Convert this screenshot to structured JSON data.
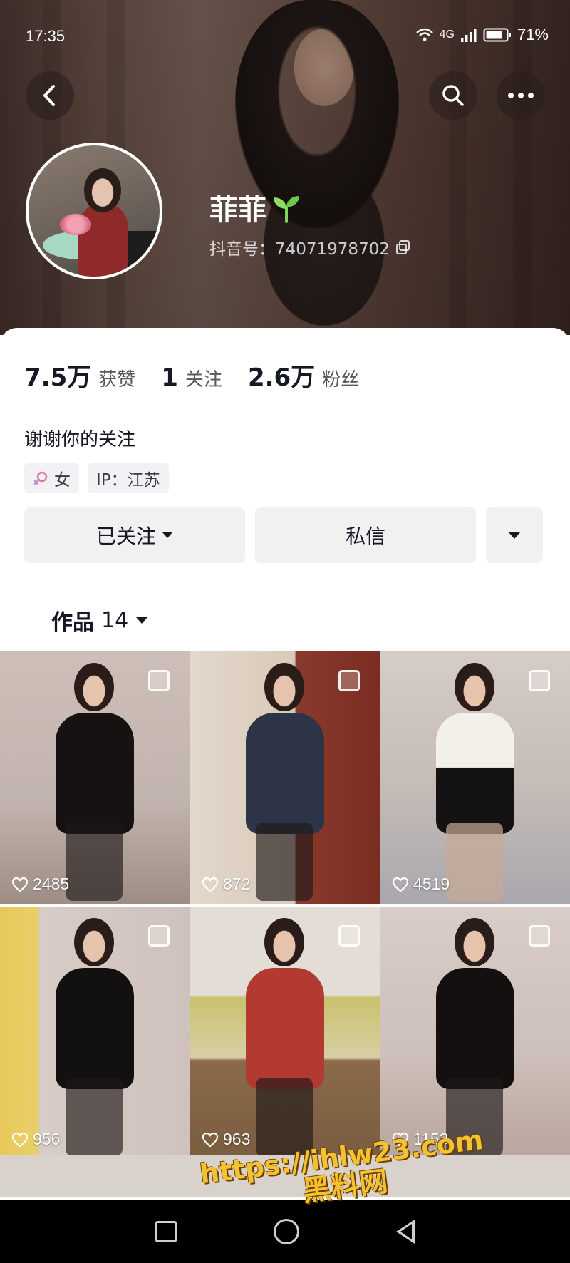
{
  "status": {
    "time": "17:35",
    "network": "4G",
    "battery": "71%"
  },
  "profile": {
    "nickname": "菲菲",
    "douyin_id_label": "抖音号：74071978702"
  },
  "stats": [
    {
      "value": "7.5万",
      "label": "获赞"
    },
    {
      "value": "1",
      "label": "关注"
    },
    {
      "value": "2.6万",
      "label": "粉丝"
    }
  ],
  "bio": "谢谢你的关注",
  "tags": {
    "gender": "女",
    "ip": "IP：江苏"
  },
  "actions": {
    "follow": "已关注",
    "message": "私信"
  },
  "works": {
    "label": "作品",
    "count": "14"
  },
  "posts": [
    {
      "likes": "2485"
    },
    {
      "likes": "872"
    },
    {
      "likes": "4519"
    },
    {
      "likes": "956"
    },
    {
      "likes": "963"
    },
    {
      "likes": "1153"
    }
  ],
  "watermark": {
    "line1": "https://ihlw23.com",
    "line2": "黑料网"
  },
  "icons": {
    "back": "chevron-left-icon",
    "search": "search-icon",
    "more": "more-dots-icon",
    "sprout": "sprout-icon",
    "copy": "copy-icon",
    "female": "female-icon",
    "caret": "caret-down-icon",
    "heart": "heart-outline-icon"
  },
  "colors": {
    "accent": "#161823",
    "tag_bg": "#f2f2f4",
    "button_bg": "#f1f1f2",
    "watermark": "#f2c230"
  }
}
